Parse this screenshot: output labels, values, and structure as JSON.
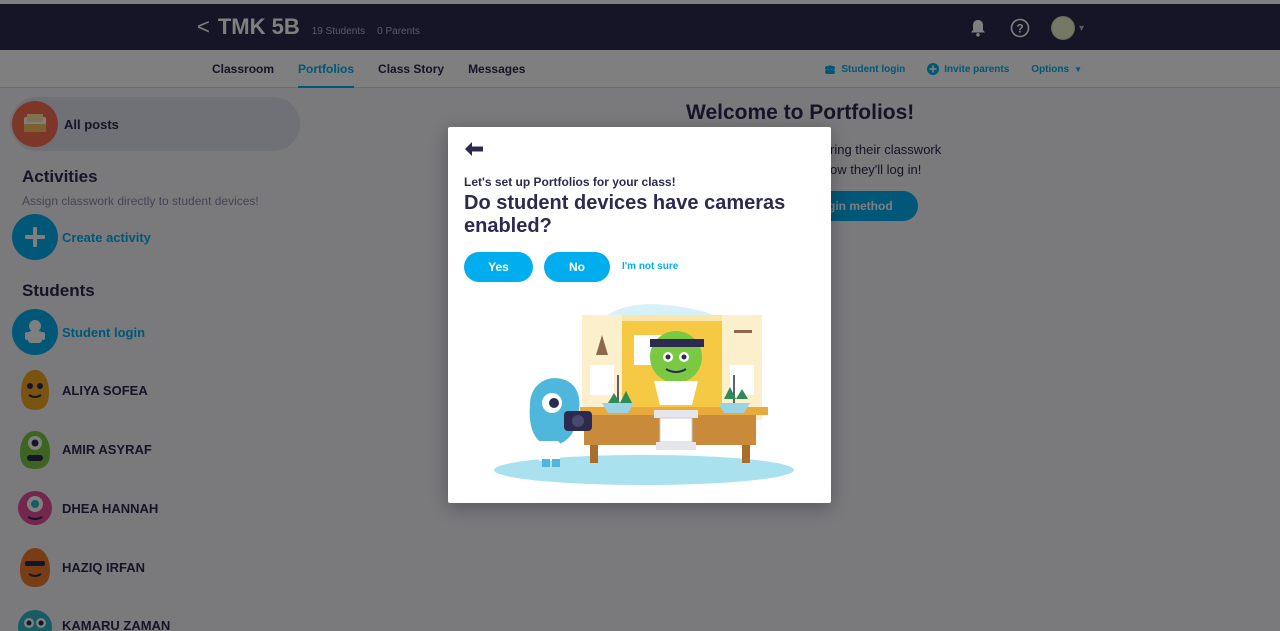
{
  "header": {
    "back_chevron": "<",
    "class_name": "TMK 5B",
    "students_count": "19 Students",
    "parents_count": "0 Parents",
    "icons": [
      "bell-icon",
      "help-icon",
      "avatar",
      "caret-down-icon"
    ]
  },
  "nav": {
    "tabs": [
      {
        "label": "Classroom",
        "active": false
      },
      {
        "label": "Portfolios",
        "active": true
      },
      {
        "label": "Class Story",
        "active": false
      },
      {
        "label": "Messages",
        "active": false
      }
    ],
    "student_login": "Student login",
    "invite_parents": "Invite parents",
    "options": "Options"
  },
  "sidebar": {
    "all_posts": "All posts",
    "activities_title": "Activities",
    "activities_sub": "Assign classwork directly to student devices!",
    "create_activity": "Create activity",
    "students_title": "Students",
    "student_login": "Student login",
    "students": [
      {
        "name": "ALIYA SOFEA",
        "color": "#f6a623"
      },
      {
        "name": "AMIR ASYRAF",
        "color": "#7ac943"
      },
      {
        "name": "DHEA HANNAH",
        "color": "#e84e9a"
      },
      {
        "name": "HAZIQ IRFAN",
        "color": "#f07a2a"
      },
      {
        "name": "KAMARU ZAMAN",
        "color": "#2fb8c9"
      }
    ]
  },
  "main": {
    "welcome_title": "Welcome to Portfolios!",
    "line1": "ring their classwork",
    "line2": "ow they'll log in!",
    "button": "gin method"
  },
  "modal": {
    "pre_title": "Let's set up Portfolios for your class!",
    "question": "Do student devices have cameras enabled?",
    "yes": "Yes",
    "no": "No",
    "not_sure": "I'm not sure"
  },
  "colors": {
    "navy": "#2c2a50",
    "accent": "#00aeef",
    "background": "#f4f5fa"
  }
}
